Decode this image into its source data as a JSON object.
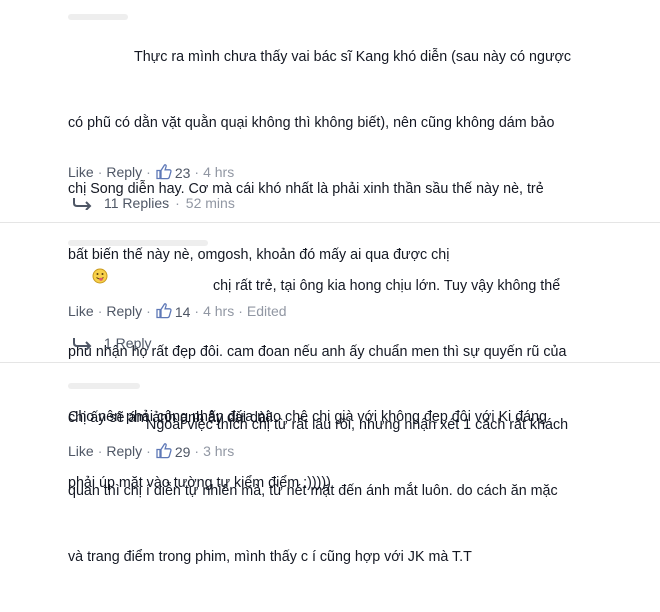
{
  "comments": [
    {
      "lines": [
        "Thực ra mình chưa thấy vai bác sĩ Kang khó diễn (sau này có ngược",
        "có phũ có dằn vặt quằn quại không thì không biết), nên cũng không dám bảo",
        "chị Song diễn hay. Cơ mà cái khó nhất là phải xinh thần sầu thế này nè, trẻ",
        "bất biến thế này nè, omgosh, khoản đó mấy ai qua được chị",
        "",
        "Cho nên phải công nhận đứa nào chê chị già với không đẹp đôi với Ki đáng",
        "phải úp mặt vào tường tự kiểm điểm :)))))"
      ],
      "like_label": "Like",
      "reply_label": "Reply",
      "like_count": "23",
      "time": "4 hrs",
      "replies_label": "11 Replies",
      "replies_time": "52 mins"
    },
    {
      "lines": [
        "chị rất trẻ, tại ông kia hong chịu lớn. Tuy vậy không thể",
        "phủ nhận họ rất đẹp đôi. cam đoan nếu anh ấy chuẩn men thì sự quyến rũ của",
        "chị ấy sẽ ám ảnh anh ấy dài dài!"
      ],
      "like_label": "Like",
      "reply_label": "Reply",
      "like_count": "14",
      "time": "4 hrs",
      "edited": "Edited",
      "replies_label": "1 Reply"
    },
    {
      "lines": [
        "Ngoài việc thích chị từ rất lâu rồi, nhưng nhận xét 1 cách rất khách",
        "quan thì chị í diễn tự nhiên mà, từ nét mặt đến ánh mắt luôn. do cách ăn mặc",
        "và trang điểm trong phim, mình thấy c í cũng hợp với JK mà T.T"
      ],
      "like_label": "Like",
      "reply_label": "Reply",
      "like_count": "29",
      "time": "3 hrs"
    }
  ],
  "colors": {
    "link": "#4e5665",
    "meta": "#9197a3",
    "like_icon": "#5f79b7"
  },
  "icons": {
    "like": "thumbs-up-icon",
    "reply": "reply-arrow-icon",
    "emoji": "tongue-emoji-icon"
  }
}
